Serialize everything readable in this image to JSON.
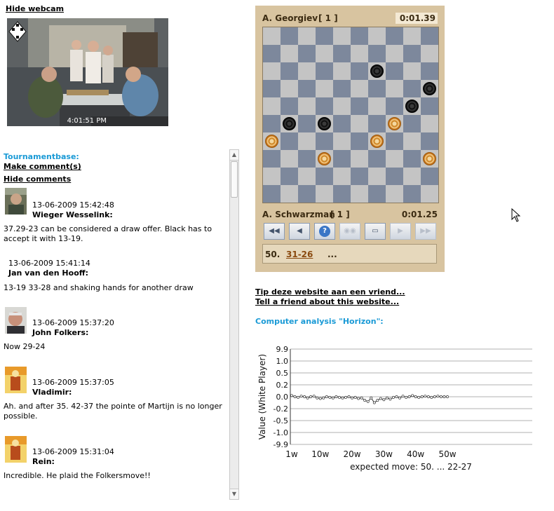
{
  "webcam": {
    "hide_label": "Hide webcam",
    "timestamp": "4:01:51 PM",
    "logo_letters": [
      "K",
      "N",
      "D",
      "B"
    ]
  },
  "sidebar": {
    "tournamentbase_label": "Tournamentbase:",
    "make_comment_label": "Make comment(s)",
    "hide_comments_label": "Hide comments"
  },
  "comments": [
    {
      "date": "13-06-2009 15:42:48",
      "name": "Wieger Wesselink:",
      "text": "37.29-23 can be considered a draw offer. Black has to accept it with 13-19.",
      "avatar": "photo-avatar"
    },
    {
      "date": "13-06-2009 15:41:14",
      "name": "Jan van den Hooff:",
      "text": "13-19 33-28 and shaking hands for another draw",
      "avatar": ""
    },
    {
      "date": "13-06-2009 15:37:20",
      "name": "John Folkers:",
      "text": "Now 29-24",
      "avatar": "photo-avatar"
    },
    {
      "date": "13-06-2009 15:37:05",
      "name": "Vladimir:",
      "text": "Ah. and after 35. 42-37 the pointe of Martijn is no longer possible.",
      "avatar": "gulsi-avatar"
    },
    {
      "date": "13-06-2009 15:31:04",
      "name": "Rein:",
      "text": "Incredible. He plaid the Folkersmove!!",
      "avatar": "gulsi-avatar"
    }
  ],
  "game": {
    "top_player": "A. Georgiev",
    "top_score": "[ 1 ]",
    "top_clock": "0:01.39",
    "bottom_player": "A. Schwarzman",
    "bottom_score": "[ 1 ]",
    "bottom_clock": "0:01.25",
    "move_number": "50.",
    "move": "31-26",
    "move_more": "...",
    "black_pieces": [
      [
        2,
        6
      ],
      [
        3,
        9
      ],
      [
        4,
        8
      ],
      [
        5,
        1
      ],
      [
        5,
        3
      ]
    ],
    "white_pieces": [
      [
        5,
        7
      ],
      [
        6,
        0
      ],
      [
        6,
        6
      ],
      [
        7,
        3
      ],
      [
        7,
        9
      ]
    ],
    "controls": [
      {
        "name": "first-move-button",
        "icon": "rewind-icon",
        "glyph": "◀◀",
        "enabled": true
      },
      {
        "name": "previous-move-button",
        "icon": "step-back-icon",
        "glyph": "◀",
        "enabled": true
      },
      {
        "name": "help-button",
        "icon": "help-icon",
        "glyph": "?",
        "enabled": true
      },
      {
        "name": "autoplay-button",
        "icon": "autoplay-icon",
        "glyph": "◉◉",
        "enabled": false
      },
      {
        "name": "window-button",
        "icon": "window-icon",
        "glyph": "▭",
        "enabled": true
      },
      {
        "name": "next-move-button",
        "icon": "step-forward-icon",
        "glyph": "▶",
        "enabled": false
      },
      {
        "name": "last-move-button",
        "icon": "fast-forward-icon",
        "glyph": "▶▶",
        "enabled": false
      }
    ]
  },
  "links": {
    "tip_nl": "Tip deze website aan een vriend...",
    "tip_en": "Tell a friend about this website..."
  },
  "analysis": {
    "title": "Computer analysis \"Horizon\":"
  },
  "chart_data": {
    "type": "line",
    "title": "",
    "ylabel": "Value (White Player)",
    "xlabel": "",
    "caption": "expected move: 50. ... 22-27",
    "y_ticks": [
      "9.9",
      "1.0",
      "0.5",
      "0.2",
      "0.0",
      "-0.2",
      "-0.5",
      "-1.0",
      "-9.9"
    ],
    "x_ticks": [
      "1w",
      "10w",
      "20w",
      "30w",
      "40w",
      "50w"
    ],
    "x_tick_moves": [
      1,
      10,
      20,
      30,
      40,
      50
    ],
    "x_range": [
      1,
      50
    ],
    "grid": true,
    "series": [
      {
        "x": [
          1,
          2,
          3,
          4,
          5,
          6,
          7,
          8,
          9,
          10,
          11,
          12,
          13,
          14,
          15,
          16,
          17,
          18,
          19,
          20,
          21,
          22,
          23,
          24,
          25,
          26,
          27,
          28,
          29,
          30,
          31,
          32,
          33,
          34,
          35,
          36,
          37,
          38,
          39,
          40,
          41,
          42,
          43,
          44,
          45,
          46,
          47,
          48,
          49,
          50
        ],
        "values": [
          0.02,
          0.0,
          -0.01,
          0.01,
          0.0,
          -0.02,
          0.0,
          0.01,
          -0.02,
          -0.03,
          -0.02,
          0.0,
          -0.01,
          -0.02,
          0.0,
          -0.01,
          -0.02,
          -0.01,
          0.0,
          -0.02,
          -0.01,
          -0.03,
          -0.02,
          -0.06,
          -0.08,
          -0.02,
          -0.1,
          -0.06,
          -0.03,
          -0.05,
          -0.02,
          -0.04,
          -0.01,
          0.0,
          -0.02,
          0.01,
          -0.01,
          0.0,
          0.02,
          0.0,
          -0.01,
          0.0,
          0.01,
          0.0,
          -0.01,
          0.0,
          0.01,
          0.0,
          0.0,
          0.0
        ]
      }
    ],
    "colors": {
      "series": "#333333",
      "grid": "#999999"
    }
  }
}
